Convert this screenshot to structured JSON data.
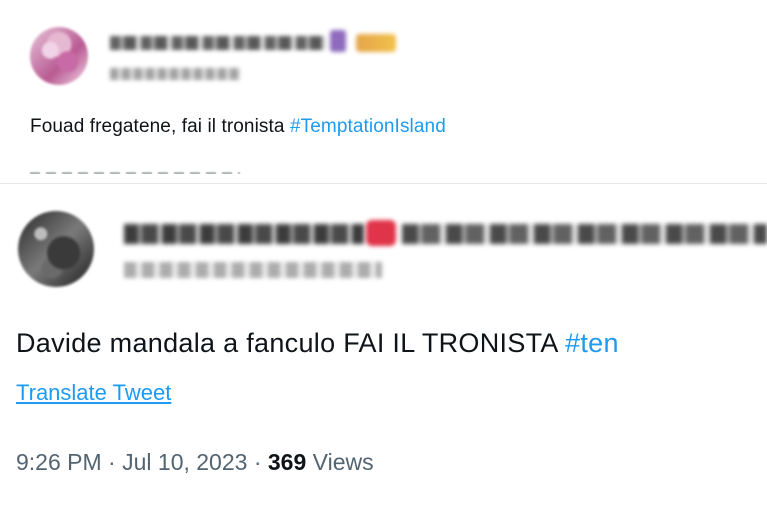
{
  "tweets": [
    {
      "text": "Fouad fregatene, fai il tronista ",
      "hashtag": "#TemptationIsland"
    },
    {
      "text": "Davide mandala a fanculo FAI IL TRONISTA ",
      "hashtag": "#ten",
      "translate_label": "Translate Tweet",
      "time": "9:26 PM",
      "separator": " · ",
      "date": "Jul 10, 2023",
      "views_count": "369",
      "views_label": " Views"
    }
  ],
  "colors": {
    "link": "#1d9bf0",
    "text": "#0f1419",
    "meta": "#536471"
  }
}
